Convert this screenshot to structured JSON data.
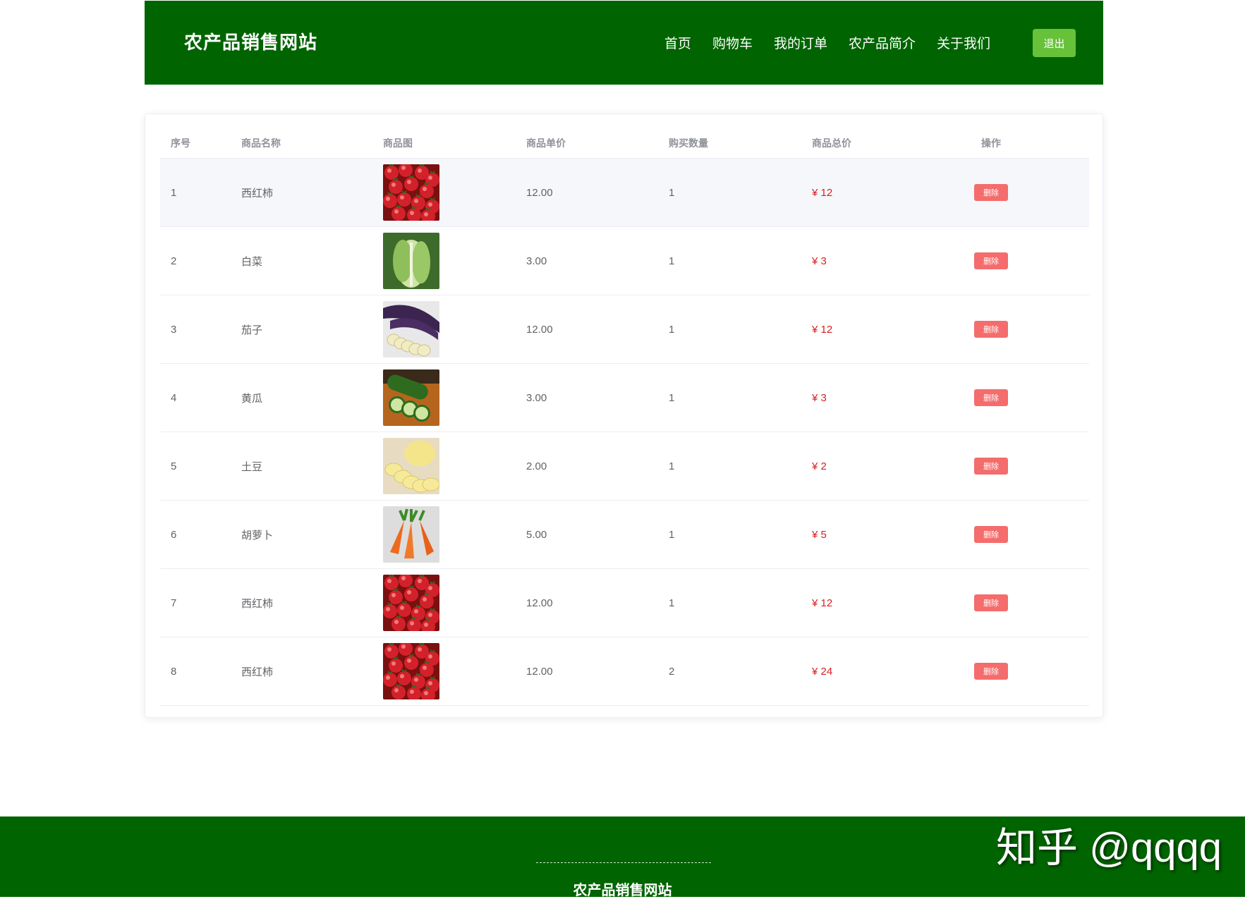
{
  "header": {
    "site_title": "农产品销售网站",
    "nav": [
      "首页",
      "购物车",
      "我的订单",
      "农产品简介",
      "关于我们"
    ],
    "logout_label": "退出"
  },
  "table": {
    "columns": [
      "序号",
      "商品名称",
      "商品图",
      "商品单价",
      "购买数量",
      "商品总价",
      "操作"
    ],
    "rows": [
      {
        "index": "1",
        "name": "西红柿",
        "image": "tomato",
        "price": "12.00",
        "qty": "1",
        "total": "¥ 12",
        "action": "删除"
      },
      {
        "index": "2",
        "name": "白菜",
        "image": "cabbage",
        "price": "3.00",
        "qty": "1",
        "total": "¥ 3",
        "action": "删除"
      },
      {
        "index": "3",
        "name": "茄子",
        "image": "eggplant",
        "price": "12.00",
        "qty": "1",
        "total": "¥ 12",
        "action": "删除"
      },
      {
        "index": "4",
        "name": "黄瓜",
        "image": "cucumber",
        "price": "3.00",
        "qty": "1",
        "total": "¥ 3",
        "action": "删除"
      },
      {
        "index": "5",
        "name": "土豆",
        "image": "potato",
        "price": "2.00",
        "qty": "1",
        "total": "¥ 2",
        "action": "删除"
      },
      {
        "index": "6",
        "name": "胡萝卜",
        "image": "carrot",
        "price": "5.00",
        "qty": "1",
        "total": "¥ 5",
        "action": "删除"
      },
      {
        "index": "7",
        "name": "西红柿",
        "image": "tomato",
        "price": "12.00",
        "qty": "1",
        "total": "¥ 12",
        "action": "删除"
      },
      {
        "index": "8",
        "name": "西红柿",
        "image": "tomato",
        "price": "12.00",
        "qty": "2",
        "total": "¥ 24",
        "action": "删除"
      }
    ]
  },
  "footer": {
    "title": "农产品销售网站"
  },
  "watermark": "知乎 @qqqq",
  "colors": {
    "brand_green": "#006400",
    "logout_green": "#67c23a",
    "danger": "#f56c6c",
    "price_red": "#d62020"
  }
}
